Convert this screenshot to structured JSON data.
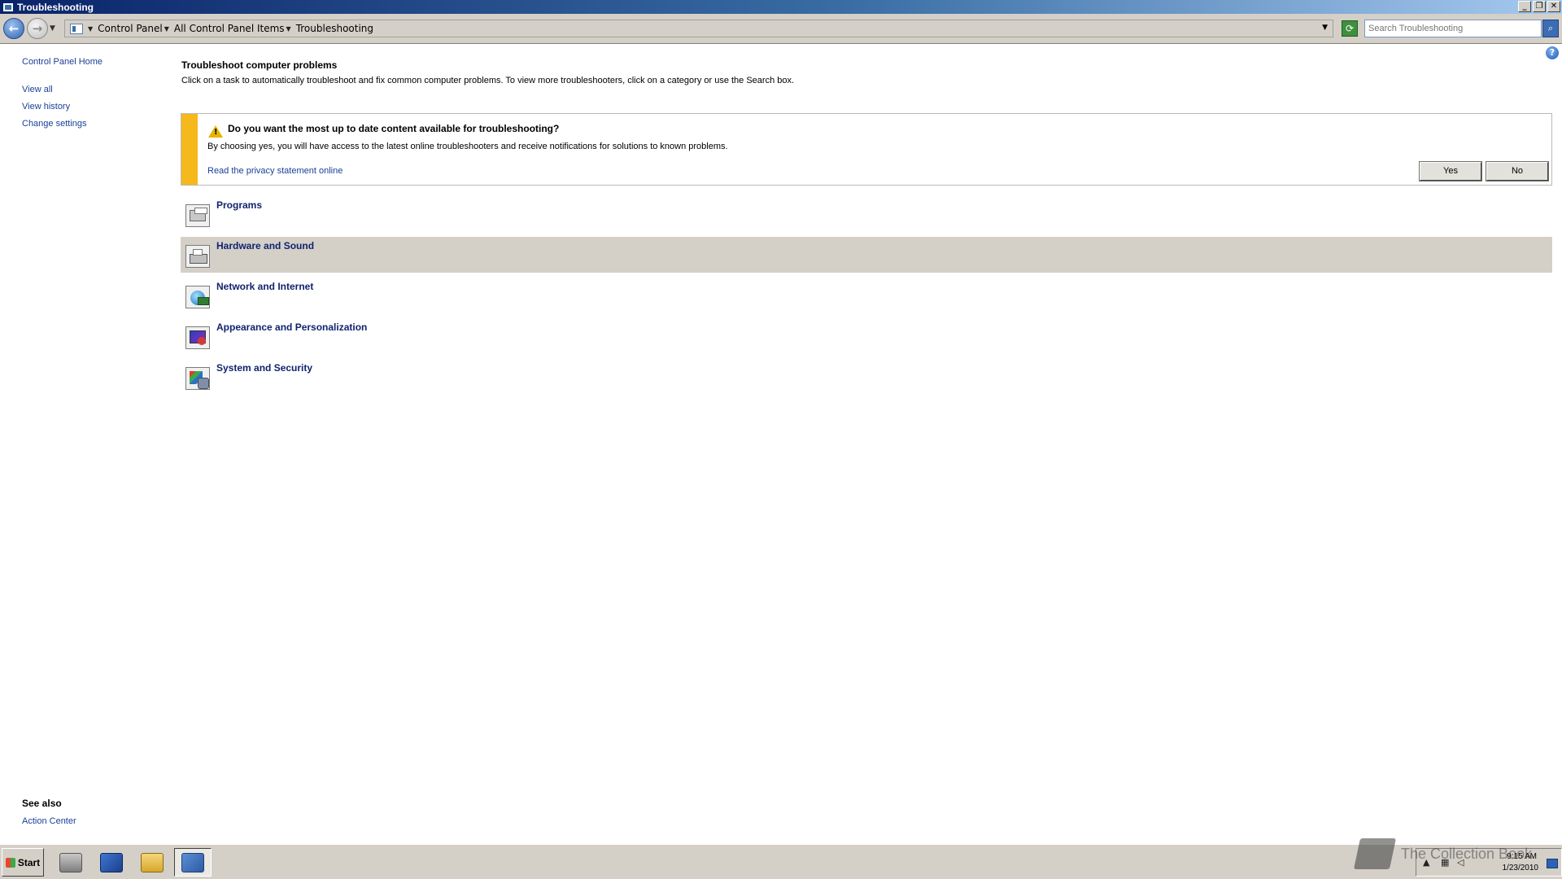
{
  "window": {
    "title": "Troubleshooting",
    "minimize": "_",
    "restore": "❐",
    "close": "✕"
  },
  "address": {
    "back": "←",
    "forward": "→",
    "breadcrumb": [
      "Control Panel",
      "All Control Panel Items",
      "Troubleshooting"
    ],
    "search_placeholder": "Search Troubleshooting"
  },
  "sidebar": {
    "home": "Control Panel Home",
    "items": [
      {
        "label": "View all"
      },
      {
        "label": "View history"
      },
      {
        "label": "Change settings"
      }
    ],
    "see_also_title": "See also",
    "see_also_items": [
      {
        "label": "Action Center"
      }
    ]
  },
  "main": {
    "title": "Troubleshoot computer problems",
    "description": "Click on a task to automatically troubleshoot and fix common computer problems. To view more troubleshooters, click on a category or use the Search box.",
    "notice": {
      "question": "Do you want the most up to date content available for troubleshooting?",
      "description": "By choosing yes, you will have access to the latest online troubleshooters and receive notifications for solutions to known problems.",
      "privacy_link": "Read the privacy statement online",
      "yes": "Yes",
      "no": "No"
    },
    "categories": [
      {
        "label": "Programs",
        "icon": "programs-icon"
      },
      {
        "label": "Hardware and Sound",
        "icon": "hardware-sound-icon"
      },
      {
        "label": "Network and Internet",
        "icon": "network-internet-icon"
      },
      {
        "label": "Appearance and Personalization",
        "icon": "appearance-icon"
      },
      {
        "label": "System and Security",
        "icon": "system-security-icon"
      }
    ]
  },
  "taskbar": {
    "start": "Start",
    "clock_time": "9:15 AM",
    "clock_date": "1/23/2010"
  },
  "watermark": {
    "text": "The Collection Book"
  },
  "colors": {
    "link": "#1a3f95",
    "category_link": "#10236e",
    "notice_bar": "#f6b91b",
    "highlight": "#d4d0c8"
  }
}
